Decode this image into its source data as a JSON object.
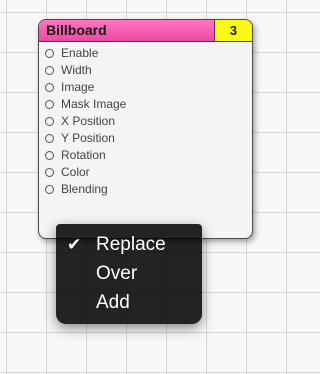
{
  "patch": {
    "title": "Billboard",
    "badge": "3",
    "ports": [
      "Enable",
      "Width",
      "Image",
      "Mask Image",
      "X Position",
      "Y Position",
      "Rotation",
      "Color",
      "Blending"
    ]
  },
  "menu": {
    "items": [
      {
        "label": "Replace",
        "checked": true,
        "check_glyph": "✔"
      },
      {
        "label": "Over",
        "checked": false,
        "check_glyph": ""
      },
      {
        "label": "Add",
        "checked": false,
        "check_glyph": ""
      }
    ]
  },
  "colors": {
    "header": "#ec4aa3",
    "badge": "#fafa18",
    "menu_background": "#000000"
  }
}
